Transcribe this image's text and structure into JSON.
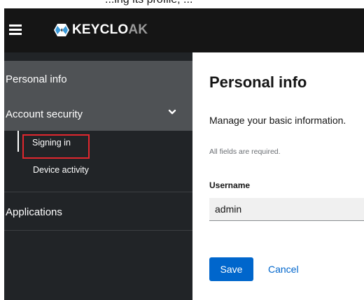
{
  "caption": {
    "cut_text": "...ing its profile, ..."
  },
  "header": {
    "logo_text_bold": "KEYCLO",
    "logo_text_light": "AK",
    "icons": {
      "menu": "hamburger-menu-icon",
      "logo": "keycloak-logo-icon"
    }
  },
  "sidebar": {
    "items": [
      {
        "label": "Personal info"
      },
      {
        "label": "Account security",
        "expanded": true,
        "icon": "chevron-down-icon"
      },
      {
        "label": "Applications"
      }
    ],
    "subitems": [
      {
        "label": "Signing in",
        "highlighted": true
      },
      {
        "label": "Device activity"
      }
    ]
  },
  "main": {
    "title": "Personal info",
    "description": "Manage your basic information.",
    "required_note": "All fields are required.",
    "username_label": "Username",
    "username_value": "admin",
    "save_label": "Save",
    "cancel_label": "Cancel"
  },
  "colors": {
    "masthead": "#151515",
    "sidebar": "#212427",
    "sidebar_active": "#4f5255",
    "primary": "#0066cc",
    "highlight": "#e0272e"
  }
}
